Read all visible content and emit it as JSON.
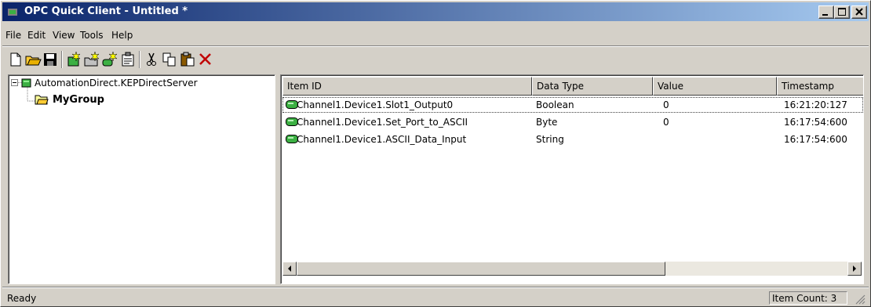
{
  "window": {
    "title": "OPC Quick Client - Untitled *"
  },
  "menu": [
    "File",
    "Edit",
    "View",
    "Tools",
    "Help"
  ],
  "toolbar": {
    "buttons": [
      "new-icon",
      "open-folder-icon",
      "save-icon",
      "new-server-icon",
      "new-group-icon",
      "new-item-icon",
      "properties-icon",
      "cut-icon",
      "copy-icon",
      "paste-icon",
      "delete-icon"
    ]
  },
  "tree": {
    "server": "AutomationDirect.KEPDirectServer",
    "group": "MyGroup"
  },
  "list": {
    "headers": [
      "Item ID",
      "Data Type",
      "Value",
      "Timestamp"
    ],
    "rows": [
      {
        "item_id": "Channel1.Device1.Slot1_Output0",
        "data_type": "Boolean",
        "value": "0",
        "timestamp": "16:21:20:127"
      },
      {
        "item_id": "Channel1.Device1.Set_Port_to_ASCII",
        "data_type": "Byte",
        "value": "0",
        "timestamp": "16:17:54:600"
      },
      {
        "item_id": "Channel1.Device1.ASCII_Data_Input",
        "data_type": "String",
        "value": "",
        "timestamp": "16:17:54:600"
      }
    ]
  },
  "status": {
    "text": "Ready",
    "item_count": "Item Count: 3"
  },
  "colors": {
    "title_start": "#0a246a",
    "title_end": "#a6caf0",
    "face": "#d4d0c8",
    "item_icon": "#3cb043"
  }
}
